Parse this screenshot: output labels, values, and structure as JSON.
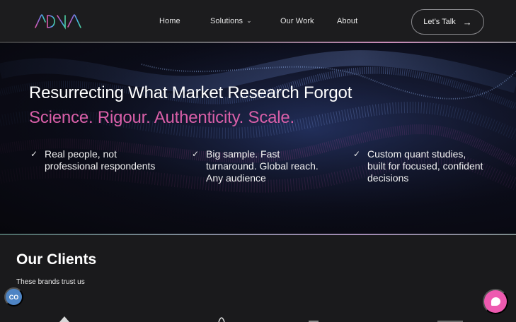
{
  "brand": {
    "logo_alt": "ADNA",
    "logo_colors": [
      "#e05aa8",
      "#7a6be0",
      "#3fb6e0",
      "#4fd0a0"
    ]
  },
  "nav": {
    "items": [
      {
        "label": "Home"
      },
      {
        "label": "Solutions",
        "has_dropdown": true
      },
      {
        "label": "Our Work"
      },
      {
        "label": "About"
      }
    ],
    "cta_label": "Let’s Talk"
  },
  "hero": {
    "title": "Resurrecting What Market Research Forgot",
    "subtitle": "Science. Rigour. Authenticity. Scale.",
    "features": [
      {
        "lines": [
          "Real people, not",
          "professional respondents"
        ]
      },
      {
        "lines": [
          "Big sample. Fast",
          "turnaround. Global reach.",
          "Any audience"
        ]
      },
      {
        "lines": [
          "Custom quant studies,",
          "built for focused, confident",
          "decisions"
        ]
      }
    ],
    "accent_color": "#d95fa8"
  },
  "clients": {
    "title": "Our Clients",
    "subtitle": "These brands trust us"
  },
  "widgets": {
    "cookie_label": "CO",
    "chat_color": "#ee5ab0"
  }
}
